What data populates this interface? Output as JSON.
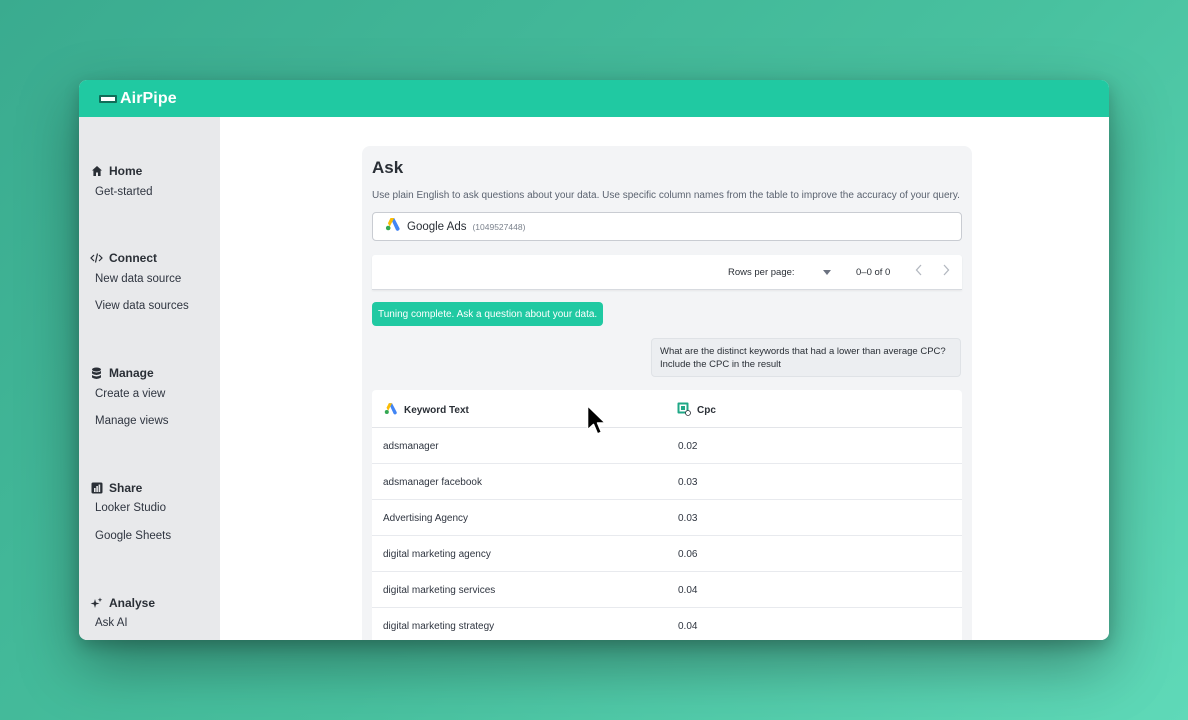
{
  "app": {
    "title": "AirPipe"
  },
  "sidebar": {
    "sections": [
      {
        "title": "Home",
        "icon": "home-icon",
        "items": [
          "Get-started"
        ]
      },
      {
        "title": "Connect",
        "icon": "code-icon",
        "items": [
          "New data source",
          "View data sources"
        ]
      },
      {
        "title": "Manage",
        "icon": "database-icon",
        "items": [
          "Create a view",
          "Manage views"
        ]
      },
      {
        "title": "Share",
        "icon": "bar-chart-icon",
        "items": [
          "Looker Studio",
          "Google Sheets"
        ]
      },
      {
        "title": "Analyse",
        "icon": "sparkle-icon",
        "items": [
          "Ask AI"
        ]
      }
    ]
  },
  "ask": {
    "title": "Ask",
    "description": "Use plain English to ask questions about your data. Use specific column names from the table to improve the accuracy of your query.",
    "source": {
      "name": "Google Ads",
      "account_id": "(1049527448)",
      "icon": "google-ads-icon"
    },
    "pager": {
      "rows_label": "Rows per page:",
      "range": "0–0 of 0"
    },
    "status_message": "Tuning complete. Ask a question about your data.",
    "question": "What are the distinct keywords that had a lower than average CPC? Include the CPC in the result"
  },
  "results": {
    "columns": [
      {
        "label": "Keyword Text",
        "icon": "google-ads-icon"
      },
      {
        "label": "Cpc",
        "icon": "calculated-field-icon"
      }
    ],
    "rows": [
      [
        "adsmanager",
        "0.02"
      ],
      [
        "adsmanager facebook",
        "0.03"
      ],
      [
        "Advertising Agency",
        "0.03"
      ],
      [
        "digital marketing agency",
        "0.06"
      ],
      [
        "digital marketing services",
        "0.04"
      ],
      [
        "digital marketing strategy",
        "0.04"
      ]
    ]
  },
  "colors": {
    "brand": "#20c9a2",
    "sidebar_bg": "#e8e9eb",
    "panel_bg": "#f3f4f6"
  }
}
